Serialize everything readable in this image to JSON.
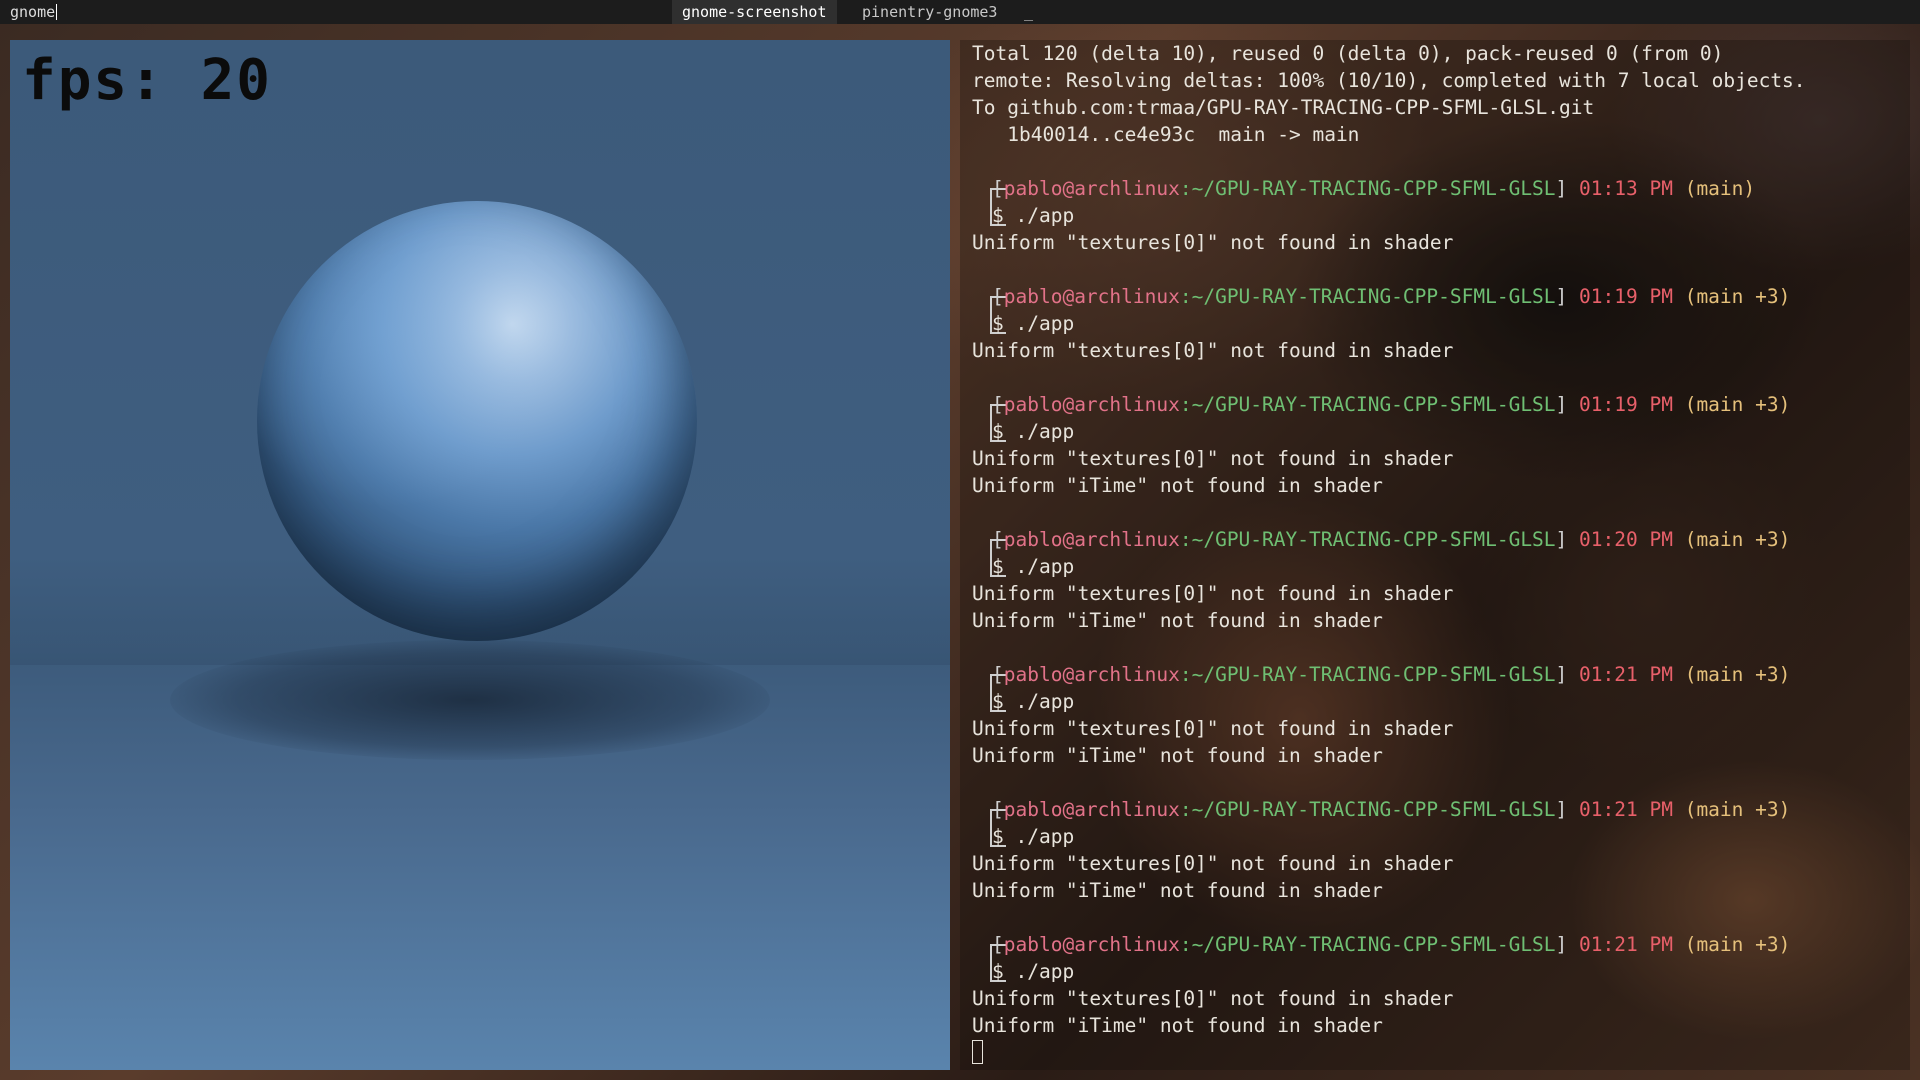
{
  "topbar": {
    "input_text": "gnome",
    "tabs": [
      {
        "label": "gnome-screenshot",
        "selected": true
      },
      {
        "label": "pinentry-gnome3",
        "selected": false
      }
    ],
    "more_indicator": "_"
  },
  "render_window": {
    "fps_label": "fps: 20"
  },
  "terminal": {
    "git_output": [
      "Total 120 (delta 10), reused 0 (delta 0), pack-reused 0 (from 0)",
      "remote: Resolving deltas: 100% (10/10), completed with 7 local objects.",
      "To github.com:trmaa/GPU-RAY-TRACING-CPP-SFML-GLSL.git",
      "   1b40014..ce4e93c  main -> main"
    ],
    "prompt": {
      "user_host": "pablo@archlinux",
      "path": ":~/GPU-RAY-TRACING-CPP-SFML-GLSL",
      "dollar": "$",
      "command": "./app"
    },
    "sessions": [
      {
        "time": "01:13 PM",
        "branch": "(main)",
        "output": [
          "Uniform \"textures[0]\" not found in shader"
        ]
      },
      {
        "time": "01:19 PM",
        "branch": "(main +3)",
        "output": [
          "Uniform \"textures[0]\" not found in shader"
        ]
      },
      {
        "time": "01:19 PM",
        "branch": "(main +3)",
        "output": [
          "Uniform \"textures[0]\" not found in shader",
          "Uniform \"iTime\" not found in shader"
        ]
      },
      {
        "time": "01:20 PM",
        "branch": "(main +3)",
        "output": [
          "Uniform \"textures[0]\" not found in shader",
          "Uniform \"iTime\" not found in shader"
        ]
      },
      {
        "time": "01:21 PM",
        "branch": "(main +3)",
        "output": [
          "Uniform \"textures[0]\" not found in shader",
          "Uniform \"iTime\" not found in shader"
        ]
      },
      {
        "time": "01:21 PM",
        "branch": "(main +3)",
        "output": [
          "Uniform \"textures[0]\" not found in shader",
          "Uniform \"iTime\" not found in shader"
        ]
      },
      {
        "time": "01:21 PM",
        "branch": "(main +3)",
        "output": [
          "Uniform \"textures[0]\" not found in shader",
          "Uniform \"iTime\" not found in shader"
        ]
      }
    ]
  },
  "colors": {
    "user": "#e27289",
    "path": "#6fbf73",
    "time": "#e8606a",
    "branch": "#e5c07b"
  }
}
